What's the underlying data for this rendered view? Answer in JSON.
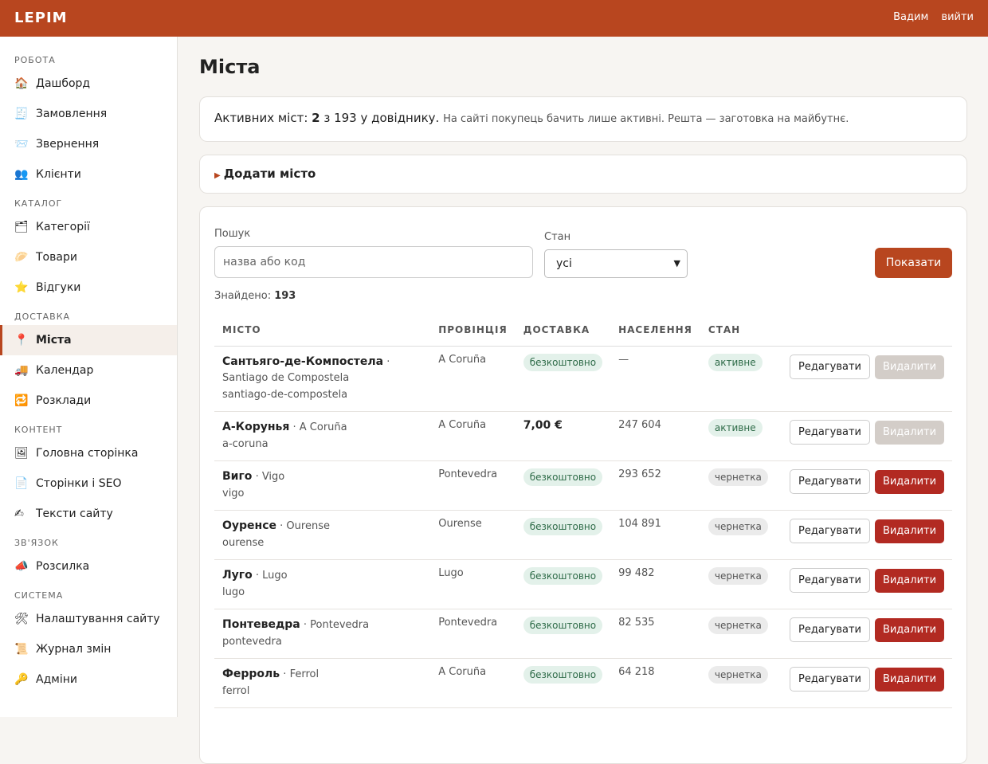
{
  "app": {
    "brand": "LEPIM",
    "user_name": "Вадим",
    "logout": "вийти"
  },
  "sidebar": [
    {
      "section": "РОБОТА",
      "items": [
        {
          "icon": "🏠",
          "label": "Дашборд"
        },
        {
          "icon": "🧾",
          "label": "Замовлення"
        },
        {
          "icon": "📨",
          "label": "Звернення"
        },
        {
          "icon": "👥",
          "label": "Клієнти"
        }
      ]
    },
    {
      "section": "КАТАЛОГ",
      "items": [
        {
          "icon": "🗂",
          "label": "Категорії"
        },
        {
          "icon": "🥟",
          "label": "Товари"
        },
        {
          "icon": "⭐",
          "label": "Відгуки"
        }
      ]
    },
    {
      "section": "ДОСТАВКА",
      "items": [
        {
          "icon": "📍",
          "label": "Міста",
          "active": true
        },
        {
          "icon": "🚚",
          "label": "Календар"
        },
        {
          "icon": "🔁",
          "label": "Розклади"
        }
      ]
    },
    {
      "section": "КОНТЕНТ",
      "items": [
        {
          "icon": "🖼",
          "label": "Головна сторінка"
        },
        {
          "icon": "📄",
          "label": "Сторінки і SEO"
        },
        {
          "icon": "✍",
          "label": "Тексти сайту"
        }
      ]
    },
    {
      "section": "ЗВ'ЯЗОК",
      "items": [
        {
          "icon": "📣",
          "label": "Розсилка"
        }
      ]
    },
    {
      "section": "СИСТЕМА",
      "items": [
        {
          "icon": "🛠",
          "label": "Налаштування сайту"
        },
        {
          "icon": "📜",
          "label": "Журнал змін"
        },
        {
          "icon": "🔑",
          "label": "Адміни"
        }
      ]
    }
  ],
  "page": {
    "title": "Міста",
    "info_prefix": "Активних міст: ",
    "info_active": "2",
    "info_suffix": " з 193 у довіднику.",
    "info_note": "На сайті покупець бачить лише активні. Решта — заготовка на майбутнє.",
    "add_label": "Додати місто"
  },
  "filters": {
    "search_label": "Пошук",
    "search_placeholder": "назва або код",
    "state_label": "Стан",
    "state_value": "усі",
    "show_button": "Показати",
    "found_label": "Знайдено:",
    "found_count": "193"
  },
  "table": {
    "headers": [
      "МІСТО",
      "ПРОВІНЦІЯ",
      "ДОСТАВКА",
      "НАСЕЛЕННЯ",
      "СТАН"
    ],
    "edit_label": "Редагувати",
    "delete_label": "Видалити",
    "rows": [
      {
        "name": "Сантьяго-де-Компостела",
        "latin": "Santiago de Compostela",
        "slug": "santiago-de-compostela",
        "province": "A Coruña",
        "delivery": "безкоштовно",
        "delivery_type": "free",
        "population": "—",
        "state": "активне",
        "state_type": "active",
        "deletable": false
      },
      {
        "name": "А-Корунья",
        "latin": "A Coruña",
        "slug": "a-coruna",
        "province": "A Coruña",
        "delivery": "7,00 €",
        "delivery_type": "price",
        "population": "247 604",
        "state": "активне",
        "state_type": "active",
        "deletable": false
      },
      {
        "name": "Виго",
        "latin": "Vigo",
        "slug": "vigo",
        "province": "Pontevedra",
        "delivery": "безкоштовно",
        "delivery_type": "free",
        "population": "293 652",
        "state": "чернетка",
        "state_type": "draft",
        "deletable": true
      },
      {
        "name": "Оуренсе",
        "latin": "Ourense",
        "slug": "ourense",
        "province": "Ourense",
        "delivery": "безкоштовно",
        "delivery_type": "free",
        "population": "104 891",
        "state": "чернетка",
        "state_type": "draft",
        "deletable": true
      },
      {
        "name": "Луго",
        "latin": "Lugo",
        "slug": "lugo",
        "province": "Lugo",
        "delivery": "безкоштовно",
        "delivery_type": "free",
        "population": "99 482",
        "state": "чернетка",
        "state_type": "draft",
        "deletable": true
      },
      {
        "name": "Понтеведра",
        "latin": "Pontevedra",
        "slug": "pontevedra",
        "province": "Pontevedra",
        "delivery": "безкоштовно",
        "delivery_type": "free",
        "population": "82 535",
        "state": "чернетка",
        "state_type": "draft",
        "deletable": true
      },
      {
        "name": "Ферроль",
        "latin": "Ferrol",
        "slug": "ferrol",
        "province": "A Coruña",
        "delivery": "безкоштовно",
        "delivery_type": "free",
        "population": "64 218",
        "state": "чернетка",
        "state_type": "draft",
        "deletable": true
      }
    ]
  }
}
